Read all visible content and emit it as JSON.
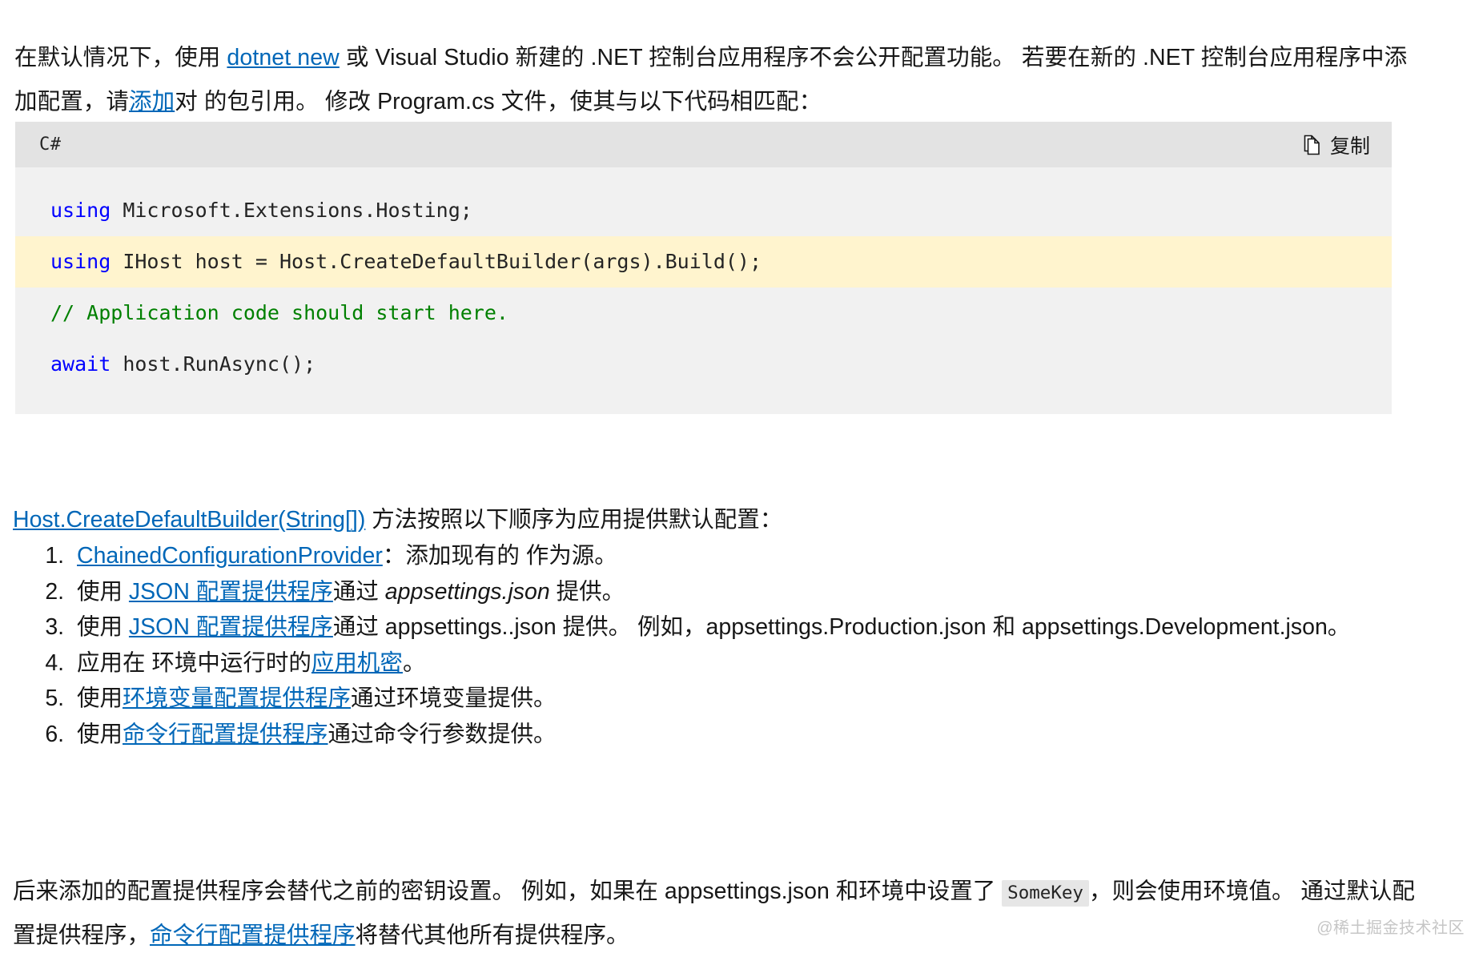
{
  "intro": {
    "seg1": "在默认情况下，使用 ",
    "link1": "dotnet new",
    "seg2": " 或 Visual Studio 新建的 .NET 控制台应用程序不会公开配置功能。 若要在新的 .NET 控制台应用程序中添加配置，请",
    "link2": "添加",
    "seg3": "对 的包引用。 修改 Program.cs 文件，使其与以下代码相匹配："
  },
  "code_block": {
    "language_label": "C#",
    "copy_label": "复制",
    "copy_icon": "copy-pages-icon",
    "header_bg": "#e3e3e3",
    "body_bg": "#f1f1f1",
    "highlight_bg": "#fff4ce",
    "keyword_color": "#0000ff",
    "comment_color": "#008000",
    "lines": [
      {
        "highlighted": false,
        "tokens": [
          {
            "text": "using",
            "kind": "keyword"
          },
          {
            "text": " Microsoft.Extensions.Hosting;",
            "kind": "plain"
          }
        ]
      },
      {
        "highlighted": true,
        "tokens": [
          {
            "text": "using",
            "kind": "keyword"
          },
          {
            "text": " IHost host = Host.CreateDefaultBuilder(args).Build();",
            "kind": "plain"
          }
        ]
      },
      {
        "highlighted": false,
        "tokens": [
          {
            "text": "// Application code should start here.",
            "kind": "comment"
          }
        ]
      },
      {
        "highlighted": false,
        "tokens": [
          {
            "text": "await",
            "kind": "keyword"
          },
          {
            "text": " host.RunAsync();",
            "kind": "plain"
          }
        ]
      }
    ]
  },
  "para_link": {
    "link": "Host.CreateDefaultBuilder(String[])",
    "rest": " 方法按照以下顺序为应用提供默认配置："
  },
  "steps": [
    {
      "index": "1",
      "parts": [
        {
          "text": "ChainedConfigurationProvider",
          "style": "link"
        },
        {
          "text": "：添加现有的 作为源。",
          "style": "plain"
        }
      ]
    },
    {
      "index": "2",
      "parts": [
        {
          "text": "使用 ",
          "style": "plain"
        },
        {
          "text": "JSON 配置提供程序",
          "style": "link"
        },
        {
          "text": "通过 ",
          "style": "plain"
        },
        {
          "text": "appsettings.json",
          "style": "italic"
        },
        {
          "text": " 提供。",
          "style": "plain"
        }
      ]
    },
    {
      "index": "3",
      "parts": [
        {
          "text": "使用 ",
          "style": "plain"
        },
        {
          "text": "JSON 配置提供程序",
          "style": "link"
        },
        {
          "text": "通过 appsettings..json 提供。 例如，appsettings.Production.json 和 appsettings.Development.json。",
          "style": "plain"
        }
      ]
    },
    {
      "index": "4",
      "parts": [
        {
          "text": "应用在 环境中运行时的",
          "style": "plain"
        },
        {
          "text": "应用机密",
          "style": "link"
        },
        {
          "text": "。",
          "style": "plain"
        }
      ]
    },
    {
      "index": "5",
      "parts": [
        {
          "text": "使用",
          "style": "plain"
        },
        {
          "text": "环境变量配置提供程序",
          "style": "link"
        },
        {
          "text": "通过环境变量提供。",
          "style": "plain"
        }
      ]
    },
    {
      "index": "6",
      "parts": [
        {
          "text": "使用",
          "style": "plain"
        },
        {
          "text": "命令行配置提供程序",
          "style": "link"
        },
        {
          "text": "通过命令行参数提供。",
          "style": "plain"
        }
      ]
    }
  ],
  "closing": {
    "seg1": "后来添加的配置提供程序会替代之前的密钥设置。 例如，如果在 appsettings.json 和环境中设置了 ",
    "code": "SomeKey",
    "seg2": "，则会使用环境值。 通过默认配置提供程序，",
    "link": "命令行配置提供程序",
    "seg3": "将替代其他所有提供程序。"
  },
  "watermark": "@稀土掘金技术社区",
  "colors": {
    "link": "#0067b8",
    "text": "#171717",
    "inline_code_bg": "#e6e6e6"
  }
}
